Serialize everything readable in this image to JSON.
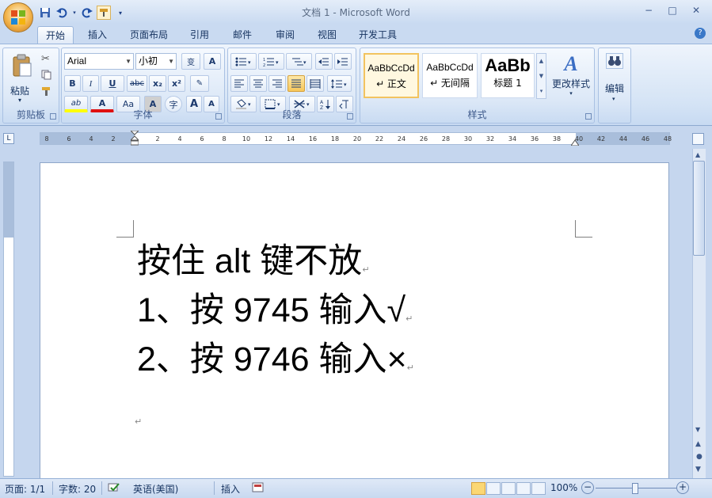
{
  "window": {
    "title": "文档 1 - Microsoft Word",
    "controls": {
      "minimize": "−",
      "maximize": "□",
      "close": "✕"
    }
  },
  "quick_access": [
    "save-icon",
    "undo-icon",
    "redo-icon",
    "format-painter-icon",
    "customize-icon"
  ],
  "tabs": [
    "开始",
    "插入",
    "页面布局",
    "引用",
    "邮件",
    "审阅",
    "视图",
    "开发工具"
  ],
  "active_tab": "开始",
  "ribbon": {
    "clipboard": {
      "paste_label": "粘贴",
      "group_label": "剪贴板"
    },
    "font": {
      "font_name": "Arial",
      "font_size": "小初",
      "wen": "变",
      "border_a": "A",
      "bold": "B",
      "italic": "I",
      "underline": "U",
      "strike": "abc",
      "subscript": "x₂",
      "superscript": "x²",
      "highlight": "ab",
      "font_color": "A",
      "case": "Aa",
      "shade_a": "A",
      "enclosed": "字",
      "grow": "A",
      "shrink": "A",
      "group_label": "字体"
    },
    "paragraph": {
      "group_label": "段落"
    },
    "styles": {
      "items": [
        {
          "sample": "AaBbCcDd",
          "name": "↵ 正文"
        },
        {
          "sample": "AaBbCcDd",
          "name": "↵ 无间隔"
        },
        {
          "sample": "AaBb",
          "name": "标题 1"
        }
      ],
      "change_styles": "更改样式",
      "group_label": "样式"
    },
    "editing": {
      "label": "编辑"
    }
  },
  "ruler": {
    "ticks": [
      "8",
      "6",
      "4",
      "2",
      "",
      "2",
      "4",
      "6",
      "8",
      "10",
      "12",
      "14",
      "16",
      "18",
      "20",
      "22",
      "24",
      "26",
      "28",
      "30",
      "32",
      "34",
      "36",
      "38",
      "40",
      "42",
      "44",
      "46",
      "48"
    ]
  },
  "document": {
    "lines": [
      "按住 alt 键不放",
      "1、按 9745 输入√",
      "2、按 9746 输入×"
    ],
    "paragraph_mark": "↵"
  },
  "status": {
    "page": "页面: 1/1",
    "words": "字数: 20",
    "language": "英语(美国)",
    "mode": "插入",
    "zoom": "100%"
  },
  "colors": {
    "accent": "#f2b34a",
    "ribbon": "#dce8f7",
    "font_color_bar": "#e01010",
    "highlight_bar": "#ffff00"
  }
}
